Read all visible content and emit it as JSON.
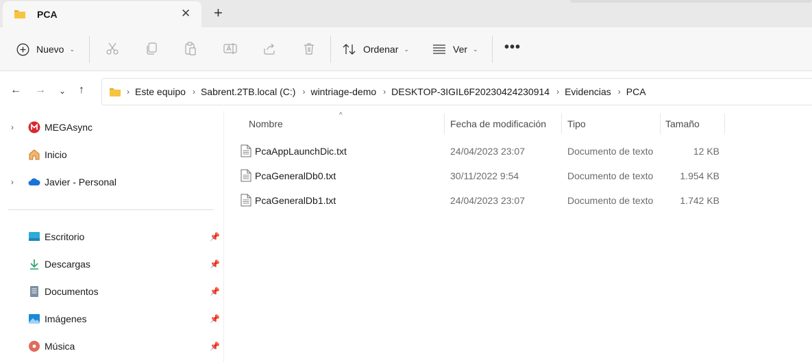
{
  "tab": {
    "title": "PCA",
    "close": "✕",
    "new_tab": "+"
  },
  "toolbar": {
    "new_label": "Nuevo",
    "sort_label": "Ordenar",
    "view_label": "Ver",
    "more_label": "•••"
  },
  "address": {
    "crumbs": [
      "Este equipo",
      "Sabrent.2TB.local (C:)",
      "wintriage-demo",
      "DESKTOP-3IGIL6F20230424230914",
      "Evidencias",
      "PCA"
    ]
  },
  "sidebar": {
    "top_items": [
      {
        "label": "MEGAsync",
        "icon": "mega-icon"
      },
      {
        "label": "Inicio",
        "icon": "home-icon"
      },
      {
        "label": "Javier - Personal",
        "icon": "onedrive-icon"
      }
    ],
    "quick_access": [
      {
        "label": "Escritorio",
        "icon": "desktop-icon"
      },
      {
        "label": "Descargas",
        "icon": "downloads-icon"
      },
      {
        "label": "Documentos",
        "icon": "documents-icon"
      },
      {
        "label": "Imágenes",
        "icon": "pictures-icon"
      },
      {
        "label": "Música",
        "icon": "music-icon"
      }
    ]
  },
  "columns": {
    "name": "Nombre",
    "date": "Fecha de modificación",
    "type": "Tipo",
    "size": "Tamaño"
  },
  "files": [
    {
      "name": "PcaAppLaunchDic.txt",
      "date": "24/04/2023 23:07",
      "type": "Documento de texto",
      "size": "12 KB"
    },
    {
      "name": "PcaGeneralDb0.txt",
      "date": "30/11/2022 9:54",
      "type": "Documento de texto",
      "size": "1.954 KB"
    },
    {
      "name": "PcaGeneralDb1.txt",
      "date": "24/04/2023 23:07",
      "type": "Documento de texto",
      "size": "1.742 KB"
    }
  ],
  "colors": {
    "folder": "#f4c542",
    "accent": "#0067c0"
  }
}
